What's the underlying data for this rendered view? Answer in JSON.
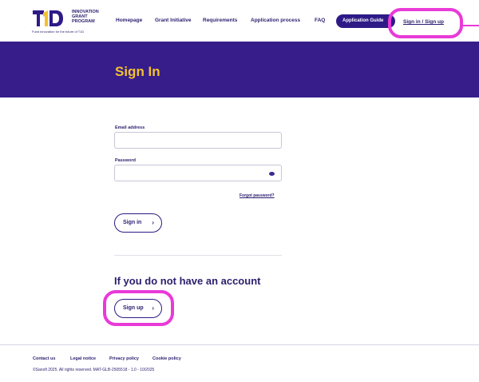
{
  "header": {
    "logo_lines": [
      "INNOVATION",
      "GRANT",
      "PROGRAM"
    ],
    "logo_tagline": "Fund innovation for the future of T1D",
    "nav": [
      "Homepage",
      "Grant Initiative",
      "Requirements",
      "Application process",
      "FAQ"
    ],
    "guide_label": "Application Guide",
    "signin_label": "Sign in / Sign up"
  },
  "banner": {
    "title": "Sign In"
  },
  "form": {
    "email_label": "Email address",
    "email_value": "",
    "password_label": "Password",
    "password_value": "",
    "forgot_label": "Forgot password?",
    "signin_button": "Sign in",
    "no_account_heading": "If you do not have an account",
    "signup_button": "Sign up"
  },
  "footer": {
    "links": [
      "Contact us",
      "Legal notice",
      "Privacy policy",
      "Cookie policy"
    ],
    "copyright": "©Sanofi 2025. All rights reserved. MAT-GLB-2505518 - 1.0 - 10/2025"
  },
  "colors": {
    "brand_purple": "#371d8a",
    "accent_yellow": "#f2c230",
    "highlight_pink": "#e93ad8"
  },
  "icons": [
    "t1d-logo-icon",
    "eye-icon",
    "chevron-right-icon"
  ]
}
